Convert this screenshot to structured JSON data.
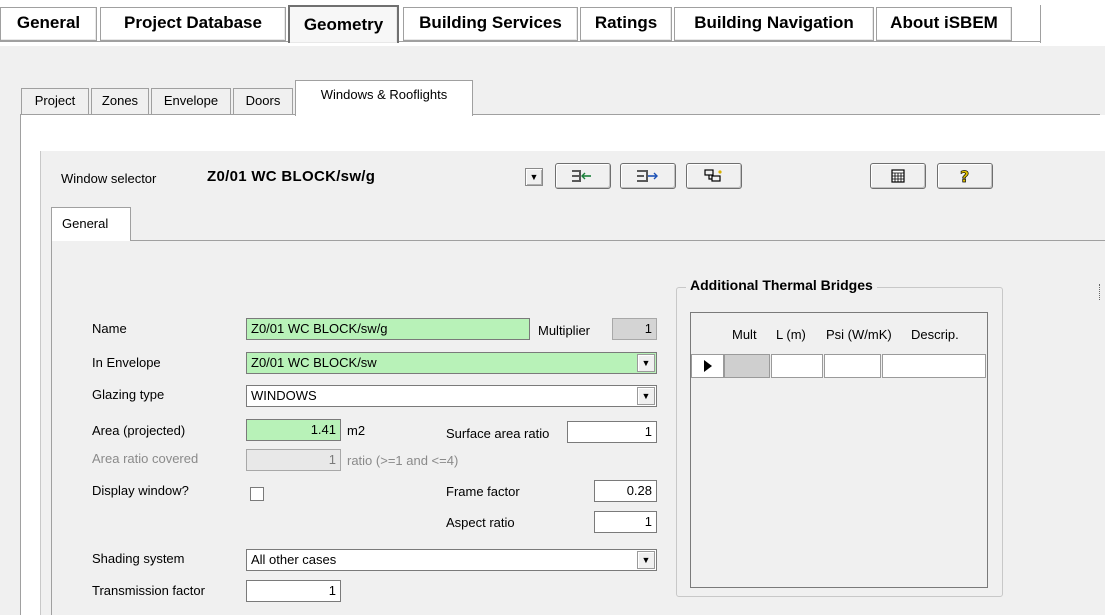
{
  "main_tabs": [
    {
      "label": "General"
    },
    {
      "label": "Project Database"
    },
    {
      "label": "Geometry"
    },
    {
      "label": "Building Services"
    },
    {
      "label": "Ratings"
    },
    {
      "label": "Building Navigation"
    },
    {
      "label": "About iSBEM"
    }
  ],
  "active_main_tab": "Geometry",
  "sub_tabs": [
    {
      "label": "Project"
    },
    {
      "label": "Zones"
    },
    {
      "label": "Envelope"
    },
    {
      "label": "Doors"
    },
    {
      "label": "Windows & Rooflights"
    }
  ],
  "active_sub_tab": "Windows & Rooflights",
  "selector": {
    "label": "Window selector",
    "value": "Z0/01 WC BLOCK/sw/g",
    "icons": [
      "add-to-list-icon",
      "move-to-list-icon",
      "copy-object-icon",
      "calculator-icon",
      "help-icon"
    ]
  },
  "inner_tab": {
    "label": "General"
  },
  "form": {
    "name_label": "Name",
    "name_value": "Z0/01 WC BLOCK/sw/g",
    "multiplier_label": "Multiplier",
    "multiplier_value": "1",
    "envelope_label": "In Envelope",
    "envelope_value": "Z0/01 WC BLOCK/sw",
    "glazing_label": "Glazing type",
    "glazing_value": "WINDOWS",
    "area_label": "Area (projected)",
    "area_value": "1.41",
    "area_unit": "m2",
    "surface_ratio_label": "Surface area ratio",
    "surface_ratio_value": "1",
    "area_covered_label": "Area ratio covered",
    "area_covered_value": "1",
    "area_covered_hint": "ratio (>=1 and <=4)",
    "display_window_label": "Display window?",
    "frame_factor_label": "Frame factor",
    "frame_factor_value": "0.28",
    "aspect_ratio_label": "Aspect ratio",
    "aspect_ratio_value": "1",
    "shading_label": "Shading system",
    "shading_value": "All other cases",
    "transmission_label": "Transmission factor",
    "transmission_value": "1"
  },
  "thermal_bridges": {
    "title": "Additional Thermal Bridges",
    "columns": [
      "Mult",
      "L (m)",
      "Psi (W/mK)",
      "Descrip."
    ]
  },
  "colors": {
    "required_field": "#b8f2b8",
    "workspace": "#f0f0f0"
  }
}
